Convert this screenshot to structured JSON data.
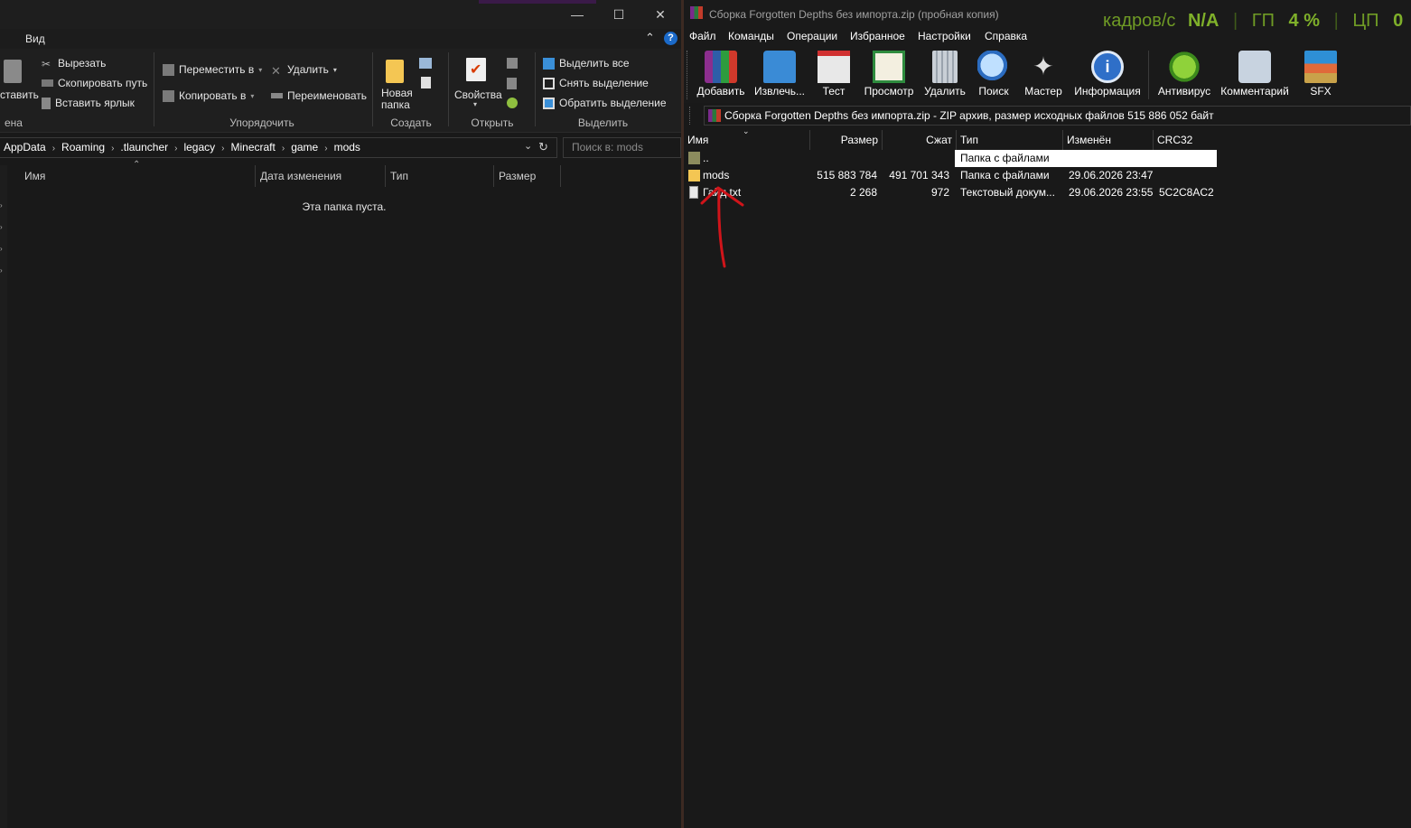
{
  "explorer": {
    "ribbon_tab_view": "Вид",
    "clipboard": {
      "paste_label": "ставить",
      "cut": "Вырезать",
      "copy_path": "Скопировать путь",
      "paste_shortcut": "Вставить ярлык",
      "group_label": "ена"
    },
    "organize": {
      "move_to": "Переместить в",
      "copy_to": "Копировать в",
      "delete": "Удалить",
      "rename": "Переименовать",
      "group_label": "Упорядочить"
    },
    "create": {
      "new_folder_line1": "Новая",
      "new_folder_line2": "папка",
      "group_label": "Создать"
    },
    "open": {
      "properties": "Свойства",
      "group_label": "Открыть"
    },
    "select": {
      "select_all": "Выделить все",
      "select_none": "Снять выделение",
      "invert": "Обратить выделение",
      "group_label": "Выделить"
    },
    "breadcrumb": [
      "AppData",
      "Roaming",
      ".tlauncher",
      "legacy",
      "Minecraft",
      "game",
      "mods"
    ],
    "search_placeholder": "Поиск в: mods",
    "columns": {
      "name": "Имя",
      "date": "Дата изменения",
      "type": "Тип",
      "size": "Размер"
    },
    "empty_message": "Эта папка пуста."
  },
  "winrar": {
    "title": "Сборка Forgotten Depths без  импорта.zip (пробная копия)",
    "menu": [
      "Файл",
      "Команды",
      "Операции",
      "Избранное",
      "Настройки",
      "Справка"
    ],
    "toolbar": {
      "add": "Добавить",
      "extract": "Извлечь...",
      "test": "Тест",
      "view": "Просмотр",
      "delete": "Удалить",
      "find": "Поиск",
      "wizard": "Мастер",
      "info": "Информация",
      "antivirus": "Антивирус",
      "comment": "Комментарий",
      "sfx": "SFX"
    },
    "path_text": "Сборка Forgotten Depths без  импорта.zip - ZIP архив, размер исходных файлов 515 886 052 байт",
    "columns": {
      "name": "Имя",
      "size": "Размер",
      "packed": "Сжат",
      "type": "Тип",
      "modified": "Изменён",
      "crc": "CRC32"
    },
    "rows": [
      {
        "name": "..",
        "size": "",
        "packed": "",
        "type": "Папка с файлами",
        "modified": "",
        "crc": ""
      },
      {
        "name": "mods",
        "size": "515 883 784",
        "packed": "491 701 343",
        "type": "Папка с файлами",
        "modified": "29.06.2026 23:47",
        "crc": ""
      },
      {
        "name": "Гайд.txt",
        "size": "2 268",
        "packed": "972",
        "type": "Текстовый докум...",
        "modified": "29.06.2026 23:55",
        "crc": "5C2C8AC2"
      }
    ]
  },
  "overlay": {
    "fps_label": "кадров/с",
    "fps_value": "N/A",
    "gpu_label": "ГП",
    "gpu_value": "4 %",
    "cpu_label": "ЦП",
    "cpu_value": "0"
  }
}
